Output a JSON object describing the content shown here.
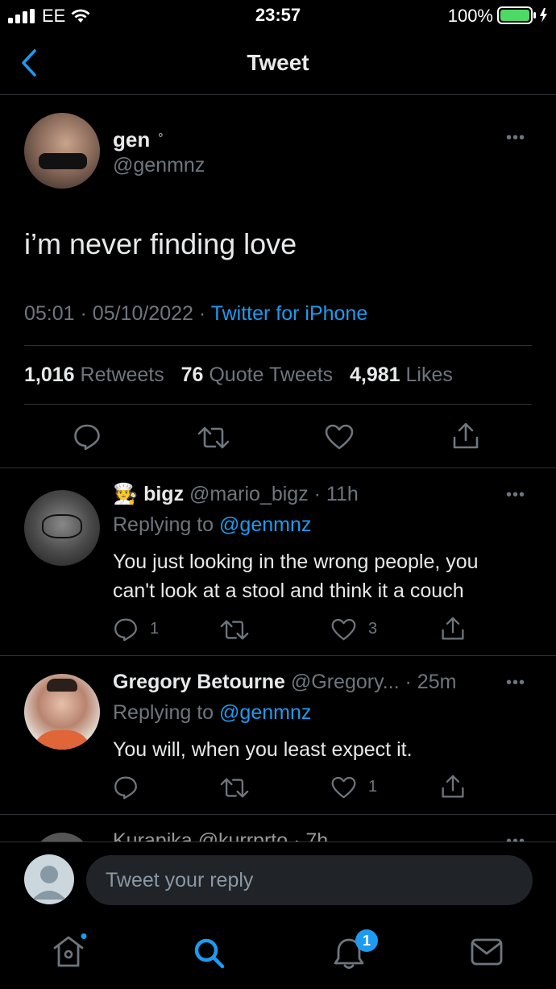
{
  "status_bar": {
    "carrier": "EE",
    "time": "23:57",
    "battery": "100%"
  },
  "nav": {
    "title": "Tweet"
  },
  "tweet": {
    "name": "gen",
    "handle": "@genmnz",
    "text": "i’m never finding love",
    "time": "05:01",
    "date": "05/10/2022",
    "source": "Twitter for iPhone",
    "retweets": "1,016",
    "retweets_label": "Retweets",
    "quotes": "76",
    "quotes_label": "Quote Tweets",
    "likes": "4,981",
    "likes_label": "Likes"
  },
  "replies": [
    {
      "emoji": "🧑‍🍳",
      "name": "bigz",
      "handle": "@mario_bigz",
      "time": "· 11h",
      "replying_prefix": "Replying to",
      "replying_to": "@genmnz",
      "text_line1": "You just looking in the wrong people, you",
      "text_line2": "can't look at a stool and think it a couch",
      "reply_count": "1",
      "like_count": "3"
    },
    {
      "name": "Gregory Betourne",
      "handle": "@Gregory...",
      "time": "· 25m",
      "replying_prefix": "Replying to",
      "replying_to": "@genmnz",
      "text_line1": "You will, when you least expect it.",
      "like_count": "1"
    },
    {
      "partial": "Kurapika  @kurrprto · 7h"
    }
  ],
  "reply_bar": {
    "placeholder": "Tweet your reply"
  },
  "tabbar": {
    "notifications_badge": "1"
  }
}
